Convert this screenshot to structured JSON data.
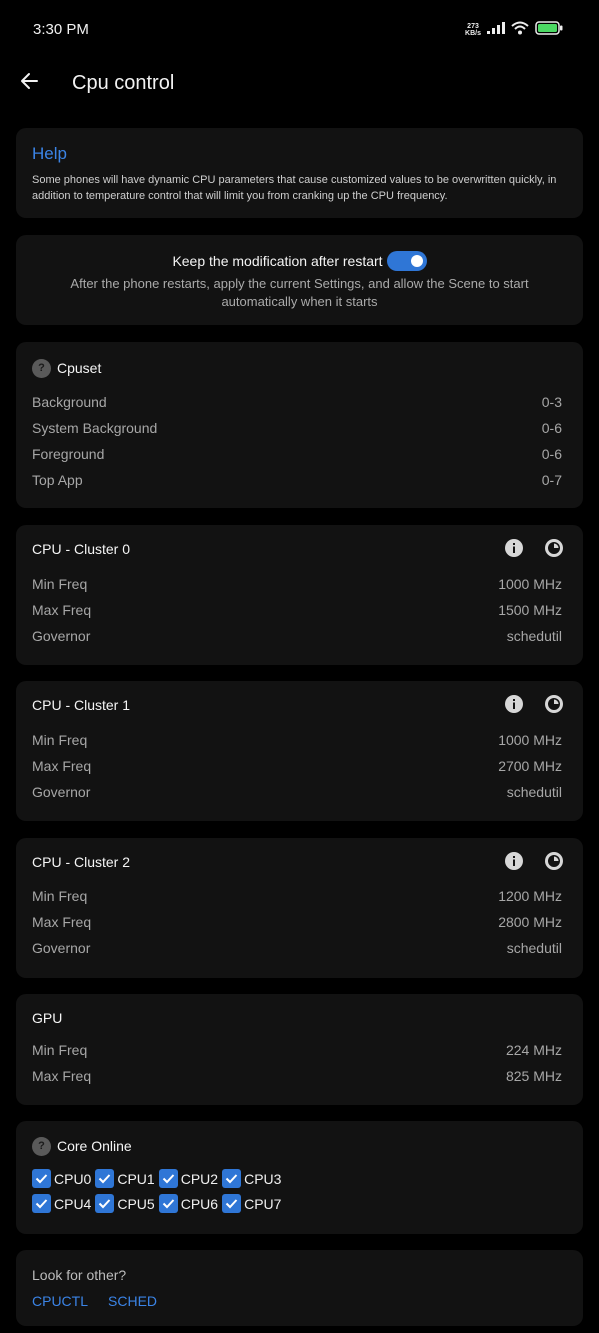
{
  "status": {
    "time": "3:30 PM",
    "net_speed_value": "273",
    "net_speed_unit": "KB/s"
  },
  "app_bar": {
    "title": "Cpu control"
  },
  "help": {
    "title": "Help",
    "text": "Some phones will have dynamic CPU parameters that cause customized values to be overwritten quickly, in addition to temperature control that will limit you from cranking up the CPU frequency."
  },
  "keep": {
    "label": "Keep the modification after restart",
    "enabled": true,
    "description": "After the phone restarts, apply the current Settings, and allow the Scene to start automatically when it starts"
  },
  "cpuset": {
    "title": "Cpuset",
    "rows": [
      {
        "label": "Background",
        "value": "0-3"
      },
      {
        "label": "System Background",
        "value": "0-6"
      },
      {
        "label": "Foreground",
        "value": "0-6"
      },
      {
        "label": "Top App",
        "value": "0-7"
      }
    ]
  },
  "clusters": [
    {
      "title": "CPU - Cluster 0",
      "rows": [
        {
          "label": "Min Freq",
          "value": "1000 MHz"
        },
        {
          "label": "Max Freq",
          "value": "1500 MHz"
        },
        {
          "label": "Governor",
          "value": "schedutil"
        }
      ]
    },
    {
      "title": "CPU - Cluster 1",
      "rows": [
        {
          "label": "Min Freq",
          "value": "1000 MHz"
        },
        {
          "label": "Max Freq",
          "value": "2700 MHz"
        },
        {
          "label": "Governor",
          "value": "schedutil"
        }
      ]
    },
    {
      "title": "CPU - Cluster 2",
      "rows": [
        {
          "label": "Min Freq",
          "value": "1200 MHz"
        },
        {
          "label": "Max Freq",
          "value": "2800 MHz"
        },
        {
          "label": "Governor",
          "value": "schedutil"
        }
      ]
    }
  ],
  "gpu": {
    "title": "GPU",
    "rows": [
      {
        "label": "Min Freq",
        "value": "224 MHz"
      },
      {
        "label": "Max Freq",
        "value": "825 MHz"
      }
    ]
  },
  "core_online": {
    "title": "Core Online",
    "cores": [
      {
        "label": "CPU0",
        "checked": true
      },
      {
        "label": "CPU1",
        "checked": true
      },
      {
        "label": "CPU2",
        "checked": true
      },
      {
        "label": "CPU3",
        "checked": true
      },
      {
        "label": "CPU4",
        "checked": true
      },
      {
        "label": "CPU5",
        "checked": true
      },
      {
        "label": "CPU6",
        "checked": true
      },
      {
        "label": "CPU7",
        "checked": true
      }
    ]
  },
  "other": {
    "label": "Look for other?",
    "links": [
      "CPUCTL",
      "SCHED"
    ]
  },
  "colors": {
    "accent": "#2f76d6",
    "link": "#3b84e6",
    "card": "#121212",
    "battery": "#4cd964"
  },
  "icons": {
    "back": "arrow-left-icon",
    "info": "info-icon",
    "pie": "pie-chart-icon",
    "help": "question-icon",
    "check": "check-icon"
  }
}
